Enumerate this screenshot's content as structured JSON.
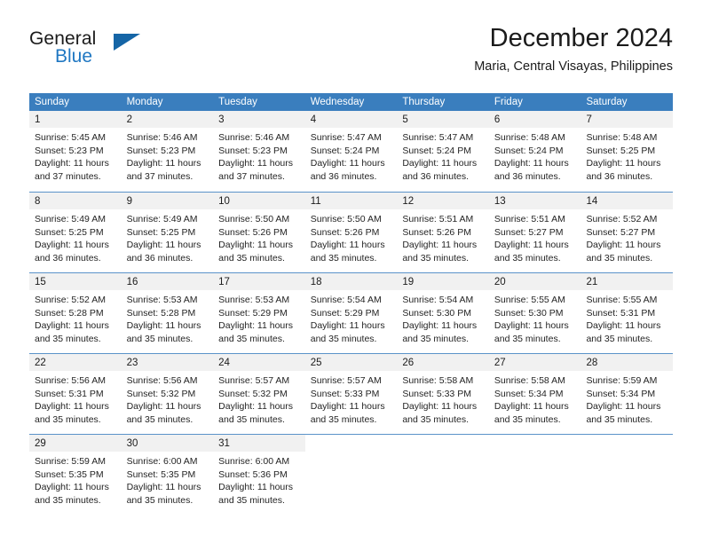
{
  "brand": {
    "name_dark": "General",
    "name_blue": "Blue",
    "triangle_color": "#1565a6",
    "blue": "#1f77c2"
  },
  "header": {
    "title": "December 2024",
    "subtitle": "Maria, Central Visayas, Philippines"
  },
  "theme": {
    "header_row_bg": "#3a7ebe",
    "header_row_text": "#ffffff",
    "daynum_band_bg": "#f1f1f1",
    "week_divider": "#5b93c9",
    "body_text": "#242424"
  },
  "weekdays": [
    "Sunday",
    "Monday",
    "Tuesday",
    "Wednesday",
    "Thursday",
    "Friday",
    "Saturday"
  ],
  "weeks": [
    [
      {
        "day": "1",
        "lines": [
          "Sunrise: 5:45 AM",
          "Sunset: 5:23 PM",
          "Daylight: 11 hours",
          "and 37 minutes."
        ]
      },
      {
        "day": "2",
        "lines": [
          "Sunrise: 5:46 AM",
          "Sunset: 5:23 PM",
          "Daylight: 11 hours",
          "and 37 minutes."
        ]
      },
      {
        "day": "3",
        "lines": [
          "Sunrise: 5:46 AM",
          "Sunset: 5:23 PM",
          "Daylight: 11 hours",
          "and 37 minutes."
        ]
      },
      {
        "day": "4",
        "lines": [
          "Sunrise: 5:47 AM",
          "Sunset: 5:24 PM",
          "Daylight: 11 hours",
          "and 36 minutes."
        ]
      },
      {
        "day": "5",
        "lines": [
          "Sunrise: 5:47 AM",
          "Sunset: 5:24 PM",
          "Daylight: 11 hours",
          "and 36 minutes."
        ]
      },
      {
        "day": "6",
        "lines": [
          "Sunrise: 5:48 AM",
          "Sunset: 5:24 PM",
          "Daylight: 11 hours",
          "and 36 minutes."
        ]
      },
      {
        "day": "7",
        "lines": [
          "Sunrise: 5:48 AM",
          "Sunset: 5:25 PM",
          "Daylight: 11 hours",
          "and 36 minutes."
        ]
      }
    ],
    [
      {
        "day": "8",
        "lines": [
          "Sunrise: 5:49 AM",
          "Sunset: 5:25 PM",
          "Daylight: 11 hours",
          "and 36 minutes."
        ]
      },
      {
        "day": "9",
        "lines": [
          "Sunrise: 5:49 AM",
          "Sunset: 5:25 PM",
          "Daylight: 11 hours",
          "and 36 minutes."
        ]
      },
      {
        "day": "10",
        "lines": [
          "Sunrise: 5:50 AM",
          "Sunset: 5:26 PM",
          "Daylight: 11 hours",
          "and 35 minutes."
        ]
      },
      {
        "day": "11",
        "lines": [
          "Sunrise: 5:50 AM",
          "Sunset: 5:26 PM",
          "Daylight: 11 hours",
          "and 35 minutes."
        ]
      },
      {
        "day": "12",
        "lines": [
          "Sunrise: 5:51 AM",
          "Sunset: 5:26 PM",
          "Daylight: 11 hours",
          "and 35 minutes."
        ]
      },
      {
        "day": "13",
        "lines": [
          "Sunrise: 5:51 AM",
          "Sunset: 5:27 PM",
          "Daylight: 11 hours",
          "and 35 minutes."
        ]
      },
      {
        "day": "14",
        "lines": [
          "Sunrise: 5:52 AM",
          "Sunset: 5:27 PM",
          "Daylight: 11 hours",
          "and 35 minutes."
        ]
      }
    ],
    [
      {
        "day": "15",
        "lines": [
          "Sunrise: 5:52 AM",
          "Sunset: 5:28 PM",
          "Daylight: 11 hours",
          "and 35 minutes."
        ]
      },
      {
        "day": "16",
        "lines": [
          "Sunrise: 5:53 AM",
          "Sunset: 5:28 PM",
          "Daylight: 11 hours",
          "and 35 minutes."
        ]
      },
      {
        "day": "17",
        "lines": [
          "Sunrise: 5:53 AM",
          "Sunset: 5:29 PM",
          "Daylight: 11 hours",
          "and 35 minutes."
        ]
      },
      {
        "day": "18",
        "lines": [
          "Sunrise: 5:54 AM",
          "Sunset: 5:29 PM",
          "Daylight: 11 hours",
          "and 35 minutes."
        ]
      },
      {
        "day": "19",
        "lines": [
          "Sunrise: 5:54 AM",
          "Sunset: 5:30 PM",
          "Daylight: 11 hours",
          "and 35 minutes."
        ]
      },
      {
        "day": "20",
        "lines": [
          "Sunrise: 5:55 AM",
          "Sunset: 5:30 PM",
          "Daylight: 11 hours",
          "and 35 minutes."
        ]
      },
      {
        "day": "21",
        "lines": [
          "Sunrise: 5:55 AM",
          "Sunset: 5:31 PM",
          "Daylight: 11 hours",
          "and 35 minutes."
        ]
      }
    ],
    [
      {
        "day": "22",
        "lines": [
          "Sunrise: 5:56 AM",
          "Sunset: 5:31 PM",
          "Daylight: 11 hours",
          "and 35 minutes."
        ]
      },
      {
        "day": "23",
        "lines": [
          "Sunrise: 5:56 AM",
          "Sunset: 5:32 PM",
          "Daylight: 11 hours",
          "and 35 minutes."
        ]
      },
      {
        "day": "24",
        "lines": [
          "Sunrise: 5:57 AM",
          "Sunset: 5:32 PM",
          "Daylight: 11 hours",
          "and 35 minutes."
        ]
      },
      {
        "day": "25",
        "lines": [
          "Sunrise: 5:57 AM",
          "Sunset: 5:33 PM",
          "Daylight: 11 hours",
          "and 35 minutes."
        ]
      },
      {
        "day": "26",
        "lines": [
          "Sunrise: 5:58 AM",
          "Sunset: 5:33 PM",
          "Daylight: 11 hours",
          "and 35 minutes."
        ]
      },
      {
        "day": "27",
        "lines": [
          "Sunrise: 5:58 AM",
          "Sunset: 5:34 PM",
          "Daylight: 11 hours",
          "and 35 minutes."
        ]
      },
      {
        "day": "28",
        "lines": [
          "Sunrise: 5:59 AM",
          "Sunset: 5:34 PM",
          "Daylight: 11 hours",
          "and 35 minutes."
        ]
      }
    ],
    [
      {
        "day": "29",
        "lines": [
          "Sunrise: 5:59 AM",
          "Sunset: 5:35 PM",
          "Daylight: 11 hours",
          "and 35 minutes."
        ]
      },
      {
        "day": "30",
        "lines": [
          "Sunrise: 6:00 AM",
          "Sunset: 5:35 PM",
          "Daylight: 11 hours",
          "and 35 minutes."
        ]
      },
      {
        "day": "31",
        "lines": [
          "Sunrise: 6:00 AM",
          "Sunset: 5:36 PM",
          "Daylight: 11 hours",
          "and 35 minutes."
        ]
      },
      {
        "day": "",
        "lines": []
      },
      {
        "day": "",
        "lines": []
      },
      {
        "day": "",
        "lines": []
      },
      {
        "day": "",
        "lines": []
      }
    ]
  ]
}
